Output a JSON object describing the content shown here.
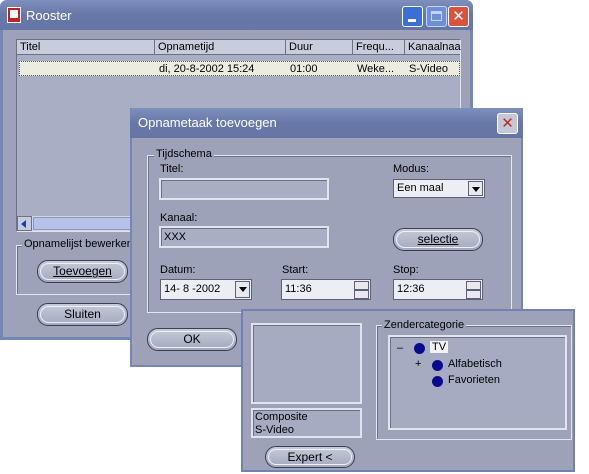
{
  "rooster": {
    "title": "Rooster",
    "columns": [
      "Titel",
      "Opnametijd",
      "Duur",
      "Frequ...",
      "Kanaalnaa"
    ],
    "rows": [
      {
        "titel": "",
        "opnametijd": "di, 20-8-2002 15:24",
        "duur": "01:00",
        "frequentie": "Weke...",
        "kanaal": "S-Video"
      }
    ],
    "group_label": "Opnamelijst bewerken",
    "add_button": "Toevoegen",
    "close_button": "Sluiten"
  },
  "dialog": {
    "title": "Opnametaak toevoegen",
    "group_label": "Tijdschema",
    "titel_label": "Titel:",
    "titel_value": "",
    "modus_label": "Modus:",
    "modus_value": "Een maal",
    "kanaal_label": "Kanaal:",
    "kanaal_value": "XXX",
    "selectie_button": "selectie",
    "datum_label": "Datum:",
    "datum_value": "14- 8 -2002",
    "start_label": "Start:",
    "start_value": "11:36",
    "stop_label": "Stop:",
    "stop_value": "12:36",
    "ok_button": "OK"
  },
  "selector": {
    "inputs": [
      "Composite",
      "S-Video"
    ],
    "category_label": "Zendercategorie",
    "tree": {
      "root": "TV",
      "root_toggle": "–",
      "child_toggle": "+",
      "children": [
        "Alfabetisch",
        "Favorieten"
      ]
    },
    "expert_button": "Expert <"
  }
}
